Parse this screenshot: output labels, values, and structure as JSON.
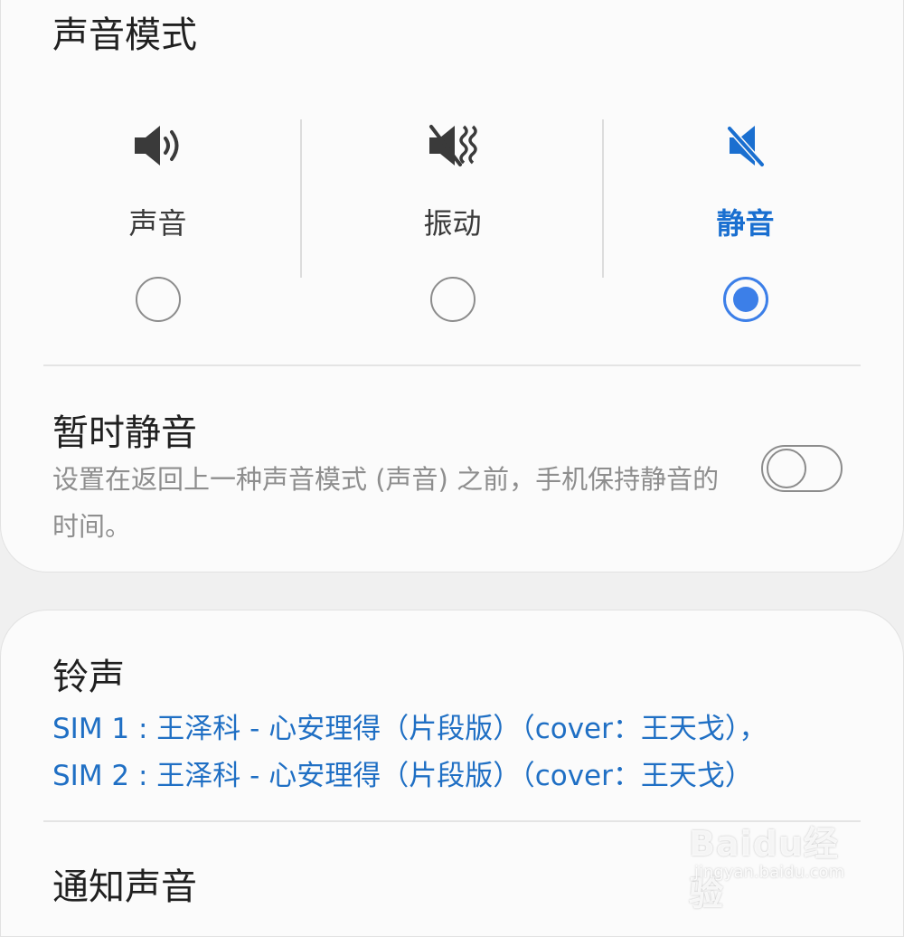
{
  "sound_mode": {
    "title": "声音模式",
    "options": [
      {
        "label": "声音",
        "icon": "speaker-icon",
        "selected": false
      },
      {
        "label": "振动",
        "icon": "vibrate-icon",
        "selected": false
      },
      {
        "label": "静音",
        "icon": "mute-icon",
        "selected": true
      }
    ]
  },
  "temporary_mute": {
    "title": "暂时静音",
    "description": "设置在返回上一种声音模式 (声音) 之前，手机保持静音的时间。",
    "enabled": false
  },
  "ringtone": {
    "title": "铃声",
    "sim1": "SIM 1 : 王泽科 - 心安理得（片段版）（cover：王天戈），",
    "sim2": "SIM 2 : 王泽科 - 心安理得（片段版）（cover：王天戈）"
  },
  "notification_sound": {
    "title": "通知声音"
  },
  "watermark": {
    "logo": "Baidu经验",
    "url": "jingyan.baidu.com"
  },
  "colors": {
    "accent": "#3c7fe8",
    "selected_label": "#1a6fd0",
    "link_text": "#1f6fc4",
    "secondary_text": "#8e8e8e",
    "card_bg": "#fbfbfb",
    "page_bg": "#f0f0f0"
  }
}
